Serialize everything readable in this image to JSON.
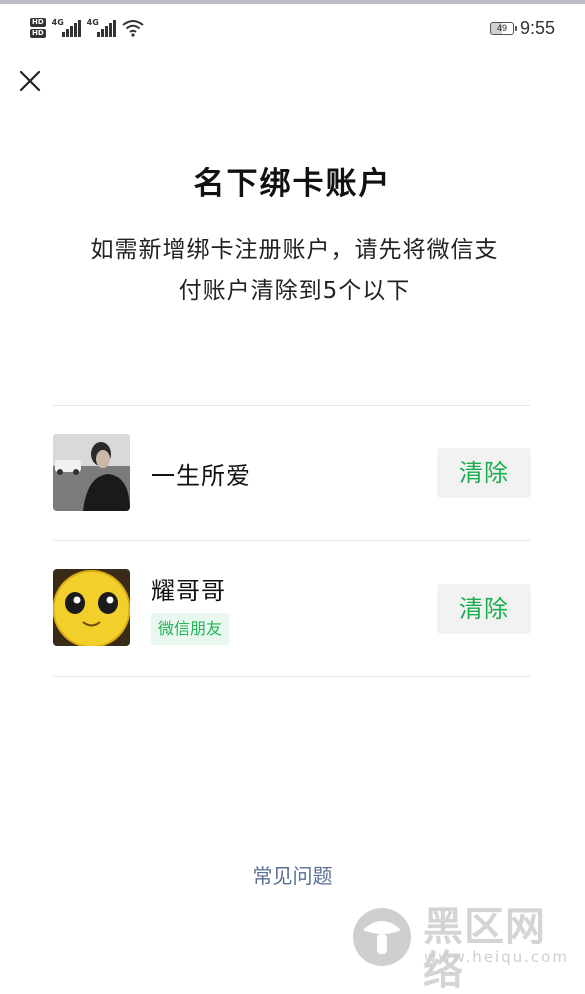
{
  "status_bar": {
    "hd_label": "HD",
    "network_label": "4G",
    "battery": "49",
    "time": "9:55"
  },
  "dialog": {
    "title": "名下绑卡账户",
    "description_line1": "如需新增绑卡注册账户，请先将微信支",
    "description_line2": "付账户清除到5个以下"
  },
  "accounts": [
    {
      "name": "一生所爱",
      "action": "清除"
    },
    {
      "name": "耀哥哥",
      "tag": "微信朋友",
      "action": "清除"
    }
  ],
  "footer": {
    "faq": "常见问题"
  },
  "watermark": {
    "text": "黑区网络",
    "url": "www.heiqu.com"
  },
  "icons": {
    "close": "close-icon",
    "signal": "signal-icon",
    "wifi": "wifi-icon",
    "battery": "battery-icon"
  },
  "colors": {
    "accent_green": "#1aad4f",
    "tag_bg": "#e9f8ee",
    "faq_link": "#5a6e90",
    "button_bg": "#f2f2f2"
  }
}
